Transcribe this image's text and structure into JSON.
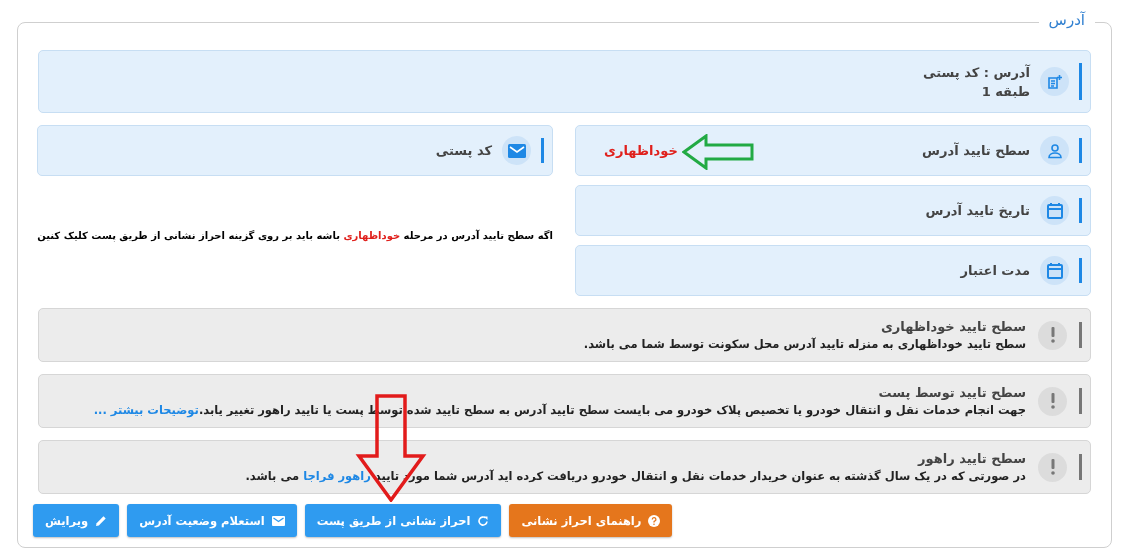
{
  "section": {
    "legend": "آدرس"
  },
  "address_card": {
    "kind": "note",
    "line_1": "آدرس : کد پستی",
    "line_2": "طبقه 1"
  },
  "postal_card": {
    "kind": "mail",
    "label": "کد پستی"
  },
  "status_fields": [
    {
      "kind": "user",
      "label": "سطح تایید آدرس",
      "value": "خوداظهاری"
    },
    {
      "kind": "calendar",
      "label": "تاریخ تایید آدرس"
    },
    {
      "kind": "calendar",
      "label": "مدت اعتبار"
    }
  ],
  "hint": {
    "before": "اگه سطح  تایید آدرس در مرحله ",
    "highlight": "خوداظهاری",
    "after": " باشه باید بر روی گزینه احراز نشانی از طریق پست کلیک کنین"
  },
  "levels": [
    {
      "title": "سطح تایید خوداظهاری",
      "segments": [
        {
          "kind": "text",
          "text": "سطح تایید خوداظهاری به منزله تایید آدرس محل سکونت توسط شما می باشد."
        }
      ]
    },
    {
      "title": "سطح تایید توسط پست",
      "segments": [
        {
          "kind": "text",
          "text": "جهت انجام خدمات نقل و انتقال خودرو یا تخصیص پلاک خودرو می بایست سطح تایید آدرس به سطح تایید شده توسط پست یا تایید راهور تغییر یابد."
        },
        {
          "kind": "link",
          "text": "توضیحات بیشتر ..."
        }
      ]
    },
    {
      "title": "سطح تایید راهور",
      "segments": [
        {
          "kind": "text",
          "text": "در صورتی که در یک سال گذشته به عنوان خریدار خدمات نقل و انتقال خودرو دریافت کرده اید آدرس شما مورد تایید "
        },
        {
          "kind": "link",
          "text": "راهور فراجا"
        },
        {
          "kind": "text",
          "text": " می باشد."
        }
      ]
    }
  ],
  "buttons": [
    {
      "kind": "help",
      "label": "راهنمای احراز نشانی",
      "color": "#e5761c"
    },
    {
      "kind": "refresh",
      "label": "احراز نشانی از طریق پست",
      "color": "#2f9bf0"
    },
    {
      "kind": "mail",
      "label": "استعلام وضعیت آدرس",
      "color": "#2f9bf0"
    },
    {
      "kind": "edit",
      "label": "ویرایش",
      "color": "#2f9bf0"
    }
  ]
}
